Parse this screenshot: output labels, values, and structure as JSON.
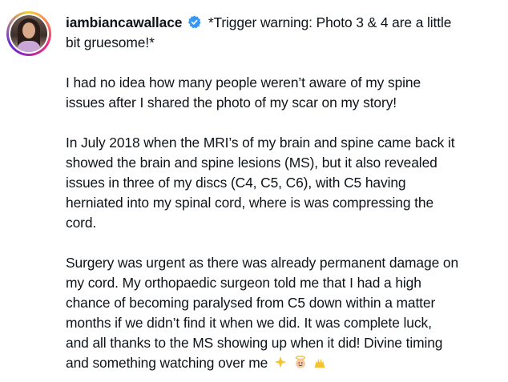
{
  "post": {
    "username": "iambiancawallace",
    "verified_icon": "verified-badge-icon",
    "accent_color": "#3897f0",
    "caption_line1_after_name": "*Trigger warning: Photo 3 & 4 are a little",
    "caption_lines": [
      "bit gruesome!*",
      "",
      "I had no idea how many people weren’t aware of my spine",
      "issues after I shared the photo of my scar on my story!",
      "",
      "In July 2018 when the MRI’s of my brain and spine came back it",
      "showed the brain and spine lesions (MS), but it also revealed",
      "issues in three of my discs (C4, C5, C6), with C5 having",
      "herniated into my spinal cord, where is was compressing the",
      "cord.",
      "",
      "Surgery was urgent as there was already permanent damage on",
      "my cord. My orthopaedic surgeon told me that I had a high",
      "chance of becoming paralysed from C5 down within a matter",
      "months if we didn’t find it when we did. It was complete luck,",
      "and all thanks to the MS showing up when it did! Divine timing",
      "and something watching over me"
    ],
    "emojis": [
      "sparkles-icon",
      "angel-icon",
      "raised-hands-icon"
    ]
  }
}
